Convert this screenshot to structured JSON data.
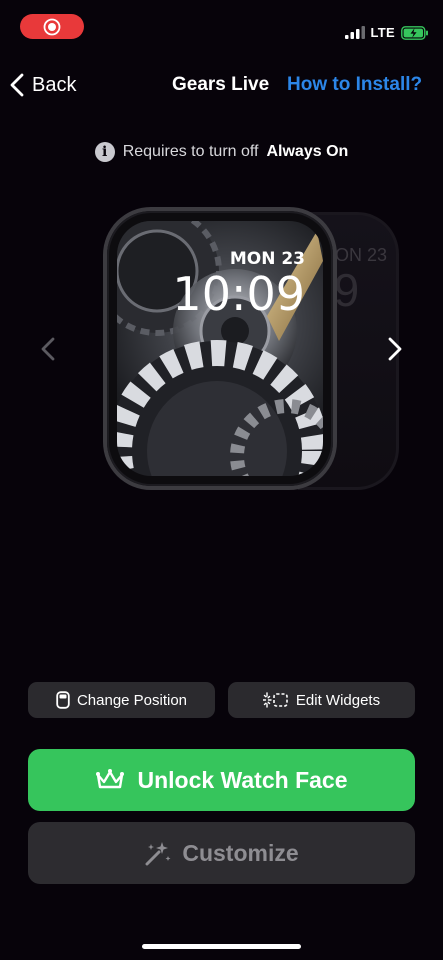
{
  "status_bar": {
    "network": "LTE",
    "icons": [
      "record-icon",
      "signal-icon",
      "battery-charging-icon"
    ],
    "colors": {
      "record": "#e8393a",
      "battery": "#36c55c"
    }
  },
  "nav": {
    "back_label": "Back",
    "title": "Gears Live",
    "help_link": "How to Install?"
  },
  "info": {
    "prefix": "Requires to turn off",
    "emphasis": "Always On",
    "icon": "info-icon"
  },
  "watch": {
    "date": "MON 23",
    "time": "10:09",
    "ghost_date": "MON 23",
    "ghost_time": "09"
  },
  "actions": {
    "change_position": "Change Position",
    "edit_widgets": "Edit Widgets",
    "unlock": "Unlock Watch Face",
    "customize": "Customize"
  },
  "colors": {
    "accent_link": "#2c86e8",
    "primary_button": "#36c55c",
    "secondary_button": "#2d2c30",
    "background": "#07030a"
  }
}
